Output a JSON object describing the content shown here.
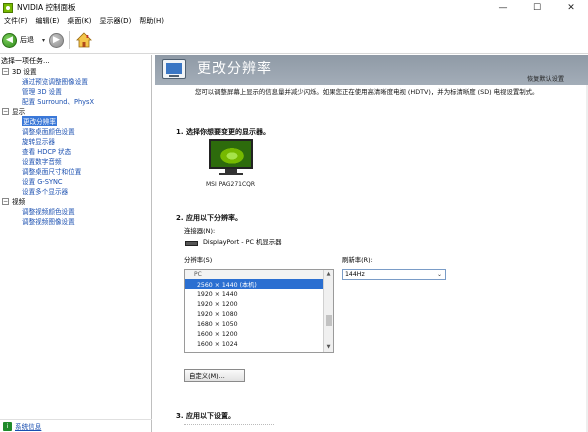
{
  "window": {
    "title": "NVIDIA 控制面板",
    "minimize": "—",
    "maximize": "☐",
    "close": "✕"
  },
  "menu": [
    "文件(F)",
    "编辑(E)",
    "桌面(K)",
    "显示器(D)",
    "帮助(H)"
  ],
  "toolbar": {
    "back_label": "后退",
    "dropdown": "▾"
  },
  "left_pane": {
    "header": "选择一项任务...",
    "tree": [
      {
        "type": "cat",
        "label": "3D 设置"
      },
      {
        "type": "child",
        "label": "通过预览调整图像设置"
      },
      {
        "type": "child",
        "label": "管理 3D 设置"
      },
      {
        "type": "child",
        "label": "配置 Surround、PhysX"
      },
      {
        "type": "cat",
        "label": "显示"
      },
      {
        "type": "child",
        "label": "更改分辨率",
        "selected": true
      },
      {
        "type": "child",
        "label": "调整桌面颜色设置"
      },
      {
        "type": "child",
        "label": "旋转显示器"
      },
      {
        "type": "child",
        "label": "查看 HDCP 状态"
      },
      {
        "type": "child",
        "label": "设置数字音频"
      },
      {
        "type": "child",
        "label": "调整桌面尺寸和位置"
      },
      {
        "type": "child",
        "label": "设置 G-SYNC"
      },
      {
        "type": "child",
        "label": "设置多个显示器"
      },
      {
        "type": "cat",
        "label": "视频"
      },
      {
        "type": "child",
        "label": "调整视频颜色设置"
      },
      {
        "type": "child",
        "label": "调整视频图像设置"
      }
    ],
    "footer_link": "系统信息"
  },
  "main": {
    "title": "更改分辨率",
    "restore_defaults": "恢复默认设置",
    "description": "您可以调整屏幕上显示的信息量并减少闪烁。如果您正在使用高清晰度电视 (HDTV)，并为标清晰度 (SD) 电视设置制式。",
    "section1_title": "1. 选择你想要变更的显示器。",
    "monitor_label": "MSI PAG271CQR",
    "section2_title": "2. 应用以下分辨率。",
    "connector_label": "连接器(N):",
    "connector_value": "DisplayPort - PC 机显示器",
    "resolution_label": "分辨率(S)",
    "refresh_label": "刷新率(R):",
    "refresh_value": "144Hz",
    "resolution_group": "PC",
    "resolutions": [
      "2560 × 1440 (本机)",
      "1920 × 1440",
      "1920 × 1200",
      "1920 × 1080",
      "1680 × 1050",
      "1600 × 1200",
      "1600 × 1024"
    ],
    "custom_button": "自定义(M)...",
    "section3_title": "3. 应用以下设置。"
  }
}
